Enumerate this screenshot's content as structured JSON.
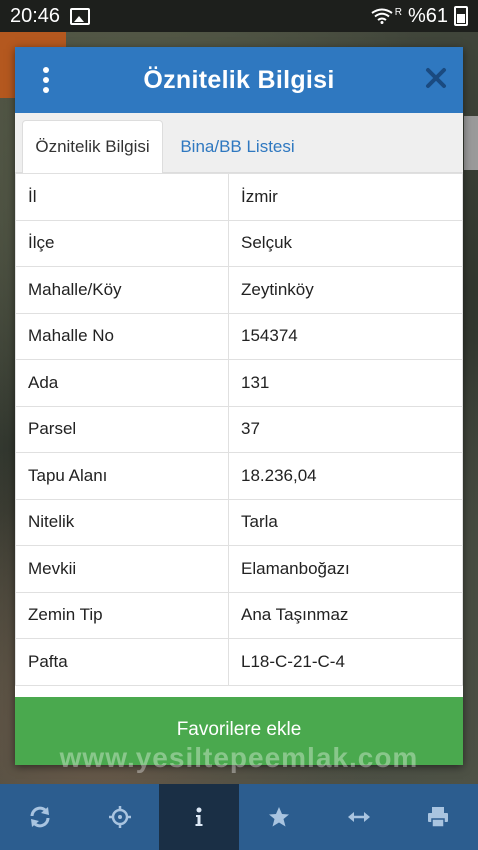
{
  "status_bar": {
    "time": "20:46",
    "signal_letter": "R",
    "battery": "%61"
  },
  "dialog": {
    "title": "Öznitelik Bilgisi",
    "tabs": [
      {
        "label": "Öznitelik Bilgisi"
      },
      {
        "label": "Bina/BB Listesi"
      }
    ],
    "rows": [
      {
        "key": "İl",
        "value": "İzmir"
      },
      {
        "key": "İlçe",
        "value": "Selçuk"
      },
      {
        "key": "Mahalle/Köy",
        "value": "Zeytinköy"
      },
      {
        "key": "Mahalle No",
        "value": "154374"
      },
      {
        "key": "Ada",
        "value": "131"
      },
      {
        "key": "Parsel",
        "value": "37"
      },
      {
        "key": "Tapu Alanı",
        "value": "18.236,04"
      },
      {
        "key": "Nitelik",
        "value": "Tarla"
      },
      {
        "key": "Mevkii",
        "value": "Elamanboğazı"
      },
      {
        "key": "Zemin Tip",
        "value": "Ana Taşınmaz"
      },
      {
        "key": "Pafta",
        "value": "L18-C-21-C-4"
      }
    ],
    "favorite_button": "Favorilere ekle"
  },
  "watermark": "www.yesiltepeemlak.com",
  "bottom_bar": {
    "icons": [
      "refresh-icon",
      "crosshair-icon",
      "info-icon",
      "star-icon",
      "measure-icon",
      "print-icon"
    ],
    "active": "info-icon"
  },
  "colors": {
    "header": "#2f78c0",
    "favorite": "#4aa94e",
    "bottom_bar": "#2c5d8f",
    "bottom_active": "#1a2f45"
  }
}
